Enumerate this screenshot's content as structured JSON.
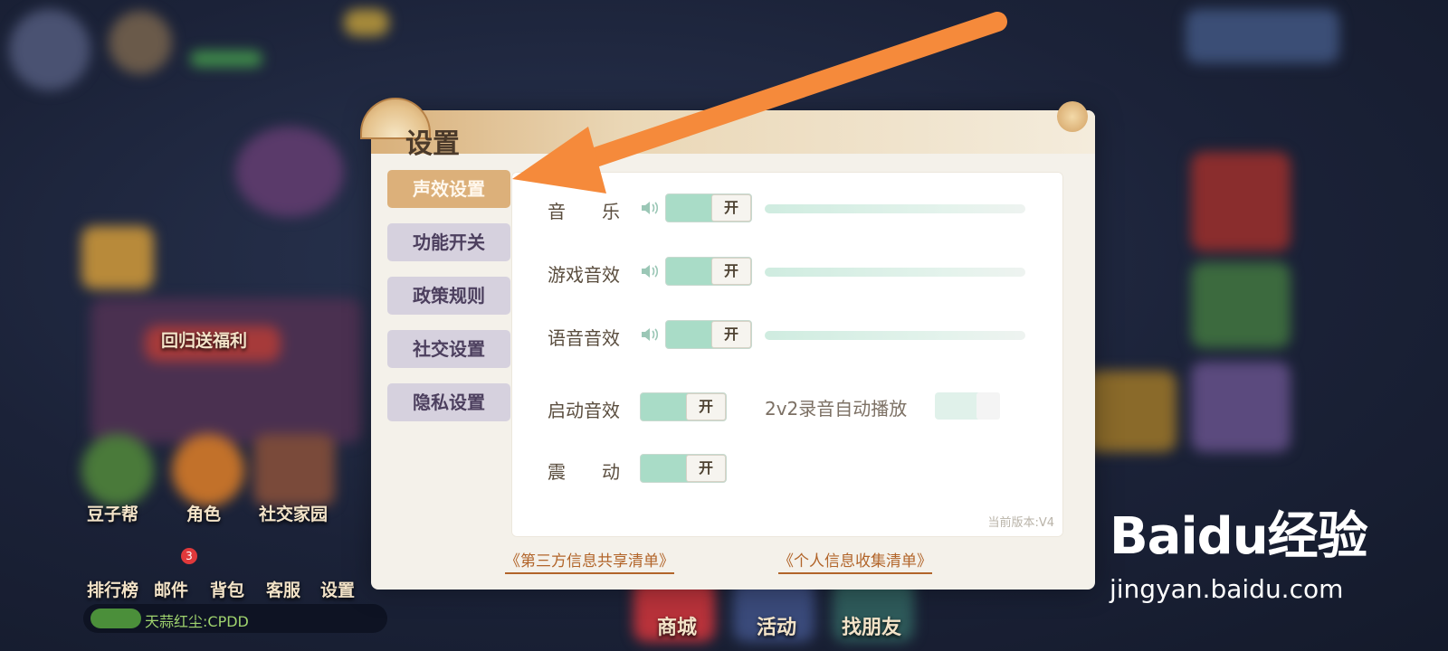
{
  "background": {
    "left_menu": [
      "回归送福利"
    ],
    "icons": [
      {
        "label": "豆子帮"
      },
      {
        "label": "角色"
      },
      {
        "label": "社交家园"
      }
    ],
    "bottom_bar": [
      {
        "label": "排行榜"
      },
      {
        "label": "邮件",
        "badge": "3"
      },
      {
        "label": "背包"
      },
      {
        "label": "客服"
      },
      {
        "label": "设置"
      }
    ],
    "chat_text": "天蒜红尘:CPDD",
    "bottom_center": [
      "商城",
      "活动",
      "找朋友"
    ]
  },
  "panel": {
    "title": "设置",
    "tabs": [
      {
        "label": "声效设置",
        "active": true
      },
      {
        "label": "功能开关",
        "active": false
      },
      {
        "label": "政策规则",
        "active": false
      },
      {
        "label": "社交设置",
        "active": false
      },
      {
        "label": "隐私设置",
        "active": false
      }
    ],
    "rows": [
      {
        "label": "音　　乐",
        "toggle": "开",
        "has_slider": true
      },
      {
        "label": "游戏音效",
        "toggle": "开",
        "has_slider": true
      },
      {
        "label": "语音音效",
        "toggle": "开",
        "has_slider": true
      },
      {
        "label": "启动音效",
        "toggle": "开",
        "has_slider": false
      },
      {
        "label": "震　　动",
        "toggle": "开",
        "has_slider": false
      }
    ],
    "autoplay_label": "2v2录音自动播放",
    "version": "当前版本:V4",
    "links": [
      "《第三方信息共享清单》",
      "《个人信息收集清单》"
    ]
  },
  "watermark": {
    "logo": "Baidu经验",
    "url": "jingyan.baidu.com"
  },
  "colors": {
    "accent_tab": "#dcb07a",
    "toggle_on": "#a9dcc7",
    "arrow": "#f58a3b",
    "link": "#b2652a"
  }
}
